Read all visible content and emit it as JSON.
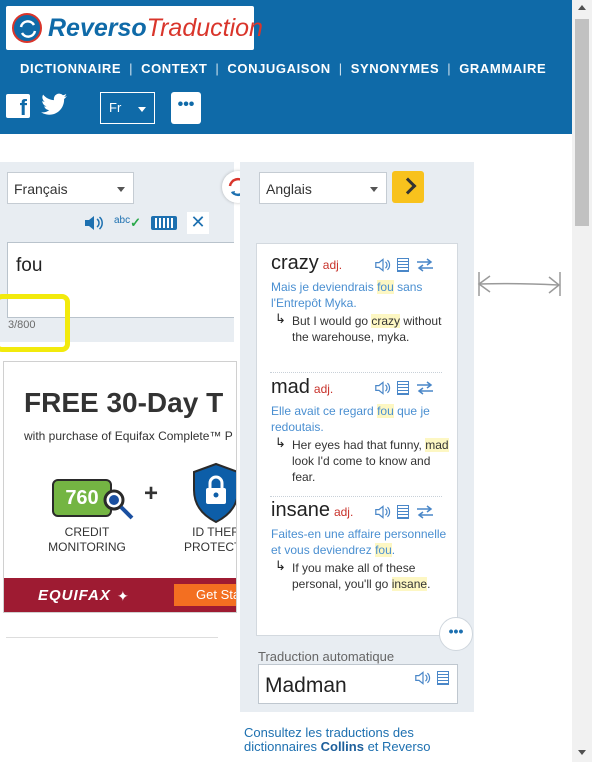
{
  "brand": {
    "name_a": "Reverso",
    "name_b": "Traduction"
  },
  "nav": [
    "DICTIONNAIRE",
    "CONTEXT",
    "CONJUGAISON",
    "SYNONYMES",
    "GRAMMAIRE"
  ],
  "header": {
    "lang": "Fr",
    "more": "•••"
  },
  "source": {
    "language": "Français",
    "text": "fou",
    "counter": "3/800",
    "spell_label": "abc"
  },
  "target": {
    "language": "Anglais"
  },
  "results": [
    {
      "word": "crazy",
      "pos": "adj.",
      "fr_pre": "Mais je deviendrais ",
      "fr_hl": "fou",
      "fr_post": " sans l'Entrepôt Myka.",
      "en_pre": "But I would go ",
      "en_hl": "crazy",
      "en_post": " without the warehouse, myka."
    },
    {
      "word": "mad",
      "pos": "adj.",
      "fr_pre": "Elle avait ce regard ",
      "fr_hl": "fou",
      "fr_post": " que je redoutais.",
      "en_pre": "Her eyes had that funny, ",
      "en_hl": "mad",
      "en_post": " look I'd come to know and fear."
    },
    {
      "word": "insane",
      "pos": "adj.",
      "fr_pre": "Faites-en une affaire personnelle et vous deviendrez ",
      "fr_hl": "fou",
      "fr_post": ".",
      "en_pre": "If you make all of these personal, you'll go ",
      "en_hl": "insane",
      "en_post": "."
    }
  ],
  "more_results": "•••",
  "auto": {
    "label": "Traduction automatique",
    "text": "Madman"
  },
  "consult": {
    "pre": "Consultez les traductions des dictionnaires ",
    "collins": "Collins",
    "mid": " et ",
    "reverso": "Reverso"
  },
  "ad": {
    "title": "FREE 30-Day T",
    "subtitle": "with purchase of Equifax Complete™ P",
    "score": "760",
    "plus": "+",
    "credit": [
      "CREDIT",
      "MONITORING"
    ],
    "idtheft": [
      "ID THEFT",
      "PROTECTIO"
    ],
    "brand": "EQUIFAX",
    "cta": "Get Sta"
  },
  "colors": {
    "brand_blue": "#0f6aa8",
    "brand_red": "#d9352b",
    "link_blue": "#4a8fd1",
    "accent_yellow": "#f8c21d",
    "annotation_yellow": "#f2ea0c"
  }
}
